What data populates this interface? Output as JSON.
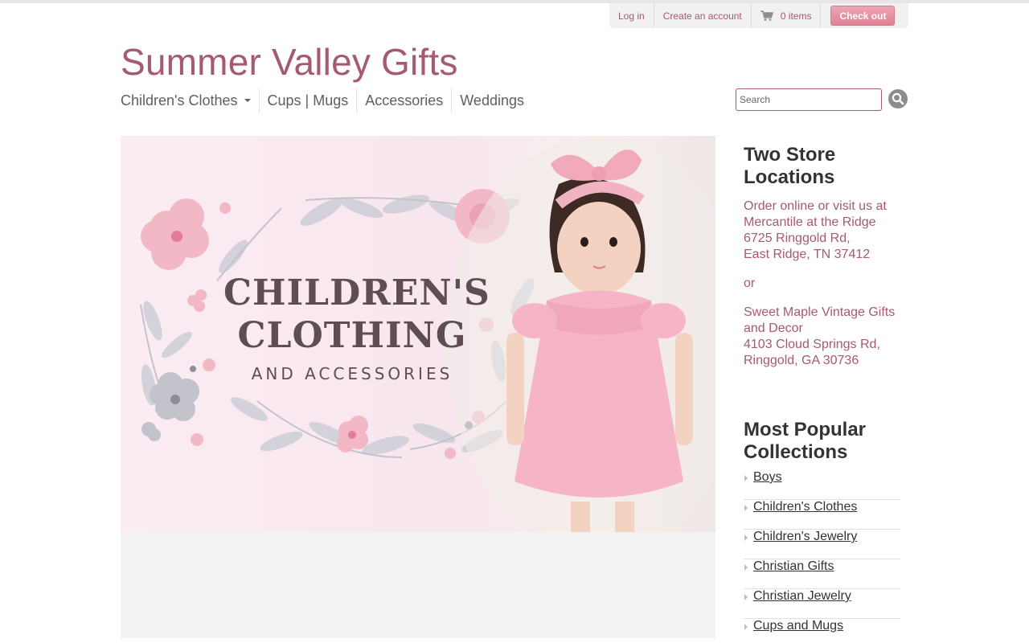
{
  "utility": {
    "login": "Log in",
    "create_account": "Create an account",
    "cart": "0 items",
    "checkout": "Check out"
  },
  "site": {
    "title": "Summer Valley Gifts"
  },
  "nav": {
    "items": [
      "Children's Clothes",
      "Cups | Mugs",
      "Accessories",
      "Weddings"
    ]
  },
  "search": {
    "placeholder": "Search"
  },
  "hero": {
    "line1": "CHILDREN'S",
    "line2": "CLOTHING",
    "line3": "AND ACCESSORIES"
  },
  "sidebar": {
    "locations_heading": "Two Store Locations",
    "store1": [
      "Order online or visit us at",
      "Mercantile at the Ridge",
      "6725 Ringgold Rd,",
      "East Ridge, TN 37412"
    ],
    "or": "or",
    "store2": [
      "Sweet Maple Vintage Gifts and Decor",
      "4103 Cloud Springs Rd,",
      "Ringgold, GA 30736"
    ],
    "popular_heading": "Most Popular Collections",
    "collections": [
      "Boys",
      "Children's Clothes",
      "Children's Jewelry",
      "Christian Gifts",
      "Christian Jewelry",
      "Cups and Mugs"
    ]
  },
  "colors": {
    "brand": "#a65a70",
    "checkout": "#e08196",
    "nav_text": "#5f5f5f"
  }
}
